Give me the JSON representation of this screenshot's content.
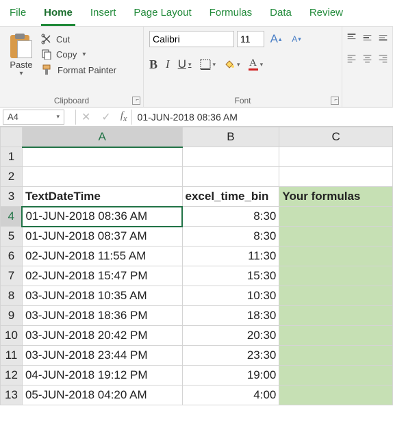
{
  "tabs": [
    "File",
    "Home",
    "Insert",
    "Page Layout",
    "Formulas",
    "Data",
    "Review"
  ],
  "active_tab": 1,
  "clipboard": {
    "paste": "Paste",
    "cut": "Cut",
    "copy": "Copy",
    "format_painter": "Format Painter",
    "group_label": "Clipboard"
  },
  "font": {
    "name": "Calibri",
    "size": "11",
    "group_label": "Font"
  },
  "name_box": "A4",
  "formula_bar": "01-JUN-2018 08:36 AM",
  "columns": [
    "A",
    "B",
    "C"
  ],
  "rows": [
    {
      "n": 1,
      "a": "",
      "b": "",
      "c": ""
    },
    {
      "n": 2,
      "a": "",
      "b": "",
      "c": ""
    },
    {
      "n": 3,
      "a": "TextDateTime",
      "b": "excel_time_bin",
      "c": "Your formulas",
      "header": true
    },
    {
      "n": 4,
      "a": "01-JUN-2018 08:36 AM",
      "b": "8:30",
      "c": "",
      "active": true
    },
    {
      "n": 5,
      "a": "01-JUN-2018 08:37 AM",
      "b": "8:30",
      "c": ""
    },
    {
      "n": 6,
      "a": "02-JUN-2018 11:55 AM",
      "b": "11:30",
      "c": ""
    },
    {
      "n": 7,
      "a": "02-JUN-2018 15:47 PM",
      "b": "15:30",
      "c": ""
    },
    {
      "n": 8,
      "a": "03-JUN-2018 10:35 AM",
      "b": "10:30",
      "c": ""
    },
    {
      "n": 9,
      "a": "03-JUN-2018 18:36 PM",
      "b": "18:30",
      "c": ""
    },
    {
      "n": 10,
      "a": "03-JUN-2018 20:42 PM",
      "b": "20:30",
      "c": ""
    },
    {
      "n": 11,
      "a": "03-JUN-2018 23:44 PM",
      "b": "23:30",
      "c": ""
    },
    {
      "n": 12,
      "a": "04-JUN-2018 19:12 PM",
      "b": "19:00",
      "c": ""
    },
    {
      "n": 13,
      "a": "05-JUN-2018 04:20 AM",
      "b": "4:00",
      "c": ""
    }
  ],
  "green_fill_start_row": 3,
  "accent_color": "#217346"
}
